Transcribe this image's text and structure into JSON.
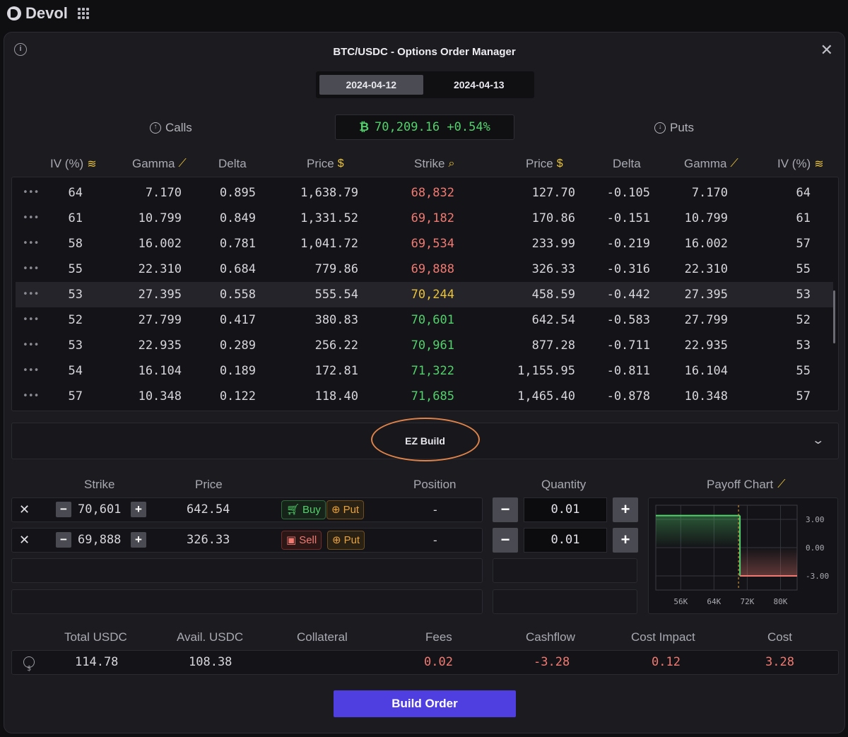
{
  "app": {
    "brand": "Devol"
  },
  "modal": {
    "title": "BTC/USDC - Options Order Manager",
    "dates": [
      {
        "label": "2024-04-12",
        "active": true
      },
      {
        "label": "2024-04-13",
        "active": false
      }
    ],
    "calls_label": "Calls",
    "puts_label": "Puts",
    "btc_price": "70,209.16 +0.54%"
  },
  "options_table": {
    "columns": [
      "IV (%)",
      "Gamma",
      "Delta",
      "Price",
      "Strike",
      "Price",
      "Delta",
      "Gamma",
      "IV (%)"
    ],
    "rows": [
      {
        "iv_c": "64",
        "gamma_c": "7.170",
        "delta_c": "0.895",
        "price_c": "1,638.79",
        "strike": "68,832",
        "price_p": "127.70",
        "delta_p": "-0.105",
        "gamma_p": "7.170",
        "iv_p": "64",
        "color": "red"
      },
      {
        "iv_c": "61",
        "gamma_c": "10.799",
        "delta_c": "0.849",
        "price_c": "1,331.52",
        "strike": "69,182",
        "price_p": "170.86",
        "delta_p": "-0.151",
        "gamma_p": "10.799",
        "iv_p": "61",
        "color": "red"
      },
      {
        "iv_c": "58",
        "gamma_c": "16.002",
        "delta_c": "0.781",
        "price_c": "1,041.72",
        "strike": "69,534",
        "price_p": "233.99",
        "delta_p": "-0.219",
        "gamma_p": "16.002",
        "iv_p": "57",
        "color": "red"
      },
      {
        "iv_c": "55",
        "gamma_c": "22.310",
        "delta_c": "0.684",
        "price_c": "779.86",
        "strike": "69,888",
        "price_p": "326.33",
        "delta_p": "-0.316",
        "gamma_p": "22.310",
        "iv_p": "55",
        "color": "red"
      },
      {
        "iv_c": "53",
        "gamma_c": "27.395",
        "delta_c": "0.558",
        "price_c": "555.54",
        "strike": "70,244",
        "price_p": "458.59",
        "delta_p": "-0.442",
        "gamma_p": "27.395",
        "iv_p": "53",
        "color": "yellow",
        "highlight": true
      },
      {
        "iv_c": "52",
        "gamma_c": "27.799",
        "delta_c": "0.417",
        "price_c": "380.83",
        "strike": "70,601",
        "price_p": "642.54",
        "delta_p": "-0.583",
        "gamma_p": "27.799",
        "iv_p": "52",
        "color": "green"
      },
      {
        "iv_c": "53",
        "gamma_c": "22.935",
        "delta_c": "0.289",
        "price_c": "256.22",
        "strike": "70,961",
        "price_p": "877.28",
        "delta_p": "-0.711",
        "gamma_p": "22.935",
        "iv_p": "53",
        "color": "green"
      },
      {
        "iv_c": "54",
        "gamma_c": "16.104",
        "delta_c": "0.189",
        "price_c": "172.81",
        "strike": "71,322",
        "price_p": "1,155.95",
        "delta_p": "-0.811",
        "gamma_p": "16.104",
        "iv_p": "55",
        "color": "green"
      },
      {
        "iv_c": "57",
        "gamma_c": "10.348",
        "delta_c": "0.122",
        "price_c": "118.40",
        "strike": "71,685",
        "price_p": "1,465.40",
        "delta_p": "-0.878",
        "gamma_p": "10.348",
        "iv_p": "57",
        "color": "green"
      }
    ]
  },
  "ez_build": {
    "label": "EZ Build"
  },
  "legs": {
    "columns": {
      "strike": "Strike",
      "price": "Price",
      "position": "Position",
      "quantity": "Quantity",
      "payoff": "Payoff Chart"
    },
    "rows": [
      {
        "strike": "70,601",
        "price": "642.54",
        "side": "Buy",
        "type": "Put",
        "position": "-",
        "quantity": "0.01"
      },
      {
        "strike": "69,888",
        "price": "326.33",
        "side": "Sell",
        "type": "Put",
        "position": "-",
        "quantity": "0.01"
      }
    ]
  },
  "payoff_chart": {
    "y_ticks": [
      "3.00",
      "0.00",
      "-3.00"
    ],
    "x_ticks": [
      "56K",
      "64K",
      "72K",
      "80K"
    ]
  },
  "chart_data": {
    "type": "line",
    "x": [
      50000,
      70244,
      70244,
      84000
    ],
    "values": [
      3.4,
      3.4,
      -3.0,
      -3.0
    ],
    "ylim": [
      -4.5,
      4.5
    ],
    "xlim": [
      50000,
      84000
    ],
    "grid": true
  },
  "summary": {
    "columns": [
      "Total USDC",
      "Avail. USDC",
      "Collateral",
      "Fees",
      "Cashflow",
      "Cost Impact",
      "Cost"
    ],
    "total_usdc": "114.78",
    "avail_usdc": "108.38",
    "collateral": "",
    "fees": "0.02",
    "cashflow": "-3.28",
    "cost_impact": "0.12",
    "cost": "3.28"
  },
  "build_order": {
    "label": "Build Order"
  },
  "colors": {
    "accent": "#4f3ee0",
    "green": "#52d16c",
    "red": "#f07a72",
    "yellow": "#e8c23a",
    "highlight_ring": "#e0834a"
  }
}
